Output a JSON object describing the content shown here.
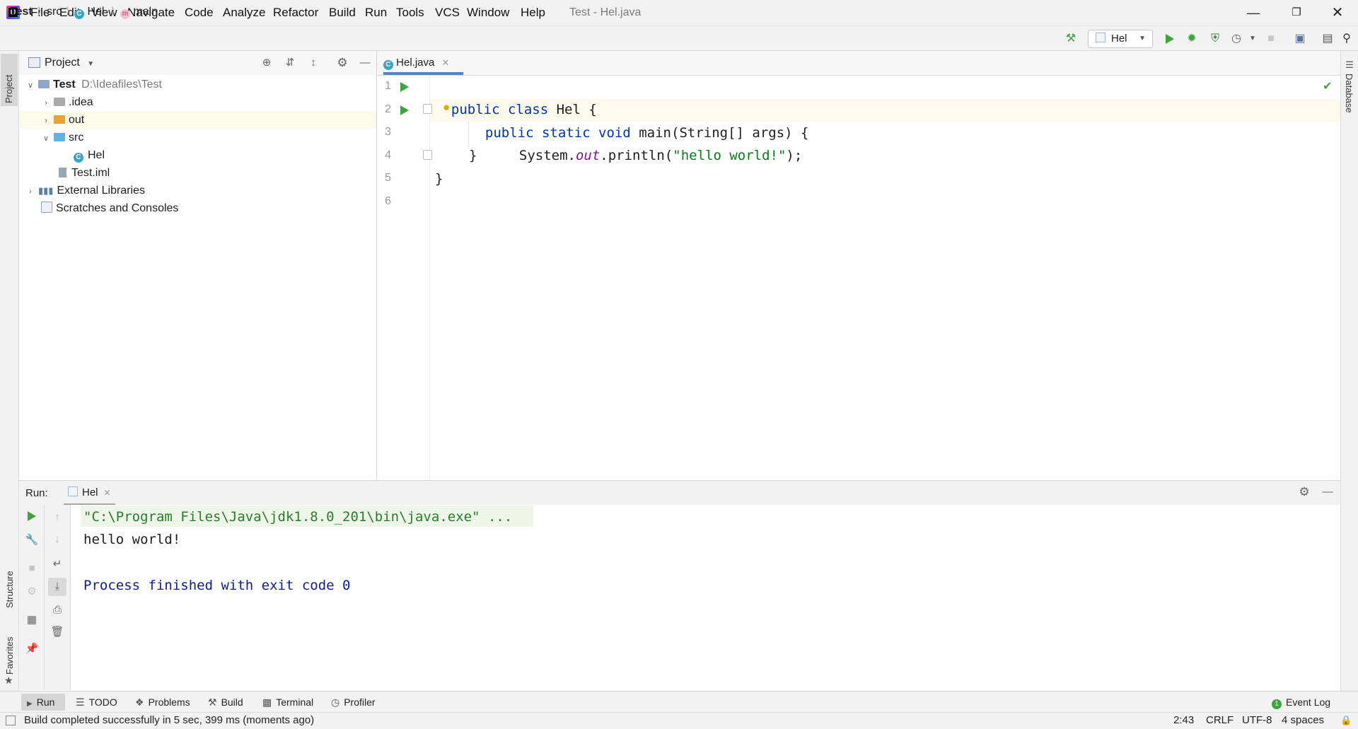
{
  "menu": [
    "File",
    "Edit",
    "View",
    "Navigate",
    "Code",
    "Analyze",
    "Refactor",
    "Build",
    "Run",
    "Tools",
    "VCS",
    "Window",
    "Help"
  ],
  "window_title": "Test - Hel.java",
  "breadcrumb": {
    "project": "Test",
    "folder": "src",
    "class": "Hel",
    "method": "main"
  },
  "run_config": "Hel",
  "project_panel": {
    "title": "Project",
    "tree": [
      {
        "label": "Test",
        "extra": "D:\\Ideafiles\\Test"
      },
      {
        "label": ".idea"
      },
      {
        "label": "out"
      },
      {
        "label": "src"
      },
      {
        "label": "Hel"
      },
      {
        "label": "Test.iml"
      },
      {
        "label": "External Libraries"
      },
      {
        "label": "Scratches and Consoles"
      }
    ]
  },
  "editor": {
    "tab": "Hel.java",
    "line_numbers": [
      "1",
      "2",
      "3",
      "4",
      "5",
      "6"
    ],
    "code": {
      "l1": {
        "kw": "public class",
        "rest": " Hel {"
      },
      "l2": {
        "kw": "public static void",
        "name": " main",
        "rest": "(String[] args) {"
      },
      "l3": {
        "pre": "System.",
        "field": "out",
        "mid": ".println(",
        "str": "\"hello world!\"",
        "post": ");"
      },
      "l4": "}",
      "l5": "}"
    }
  },
  "run_window": {
    "label": "Run:",
    "tab": "Hel",
    "console": [
      "\"C:\\Program Files\\Java\\jdk1.8.0_201\\bin\\java.exe\" ...",
      "hello world!",
      "Process finished with exit code 0"
    ]
  },
  "side_tabs": {
    "left_top": "Project",
    "left_structure": "Structure",
    "left_favorites": "Favorites",
    "right": "Database"
  },
  "tool_tabs": [
    "Run",
    "TODO",
    "Problems",
    "Build",
    "Terminal",
    "Profiler"
  ],
  "event_log": "Event Log",
  "status": {
    "message": "Build completed successfully in 5 sec, 399 ms (moments ago)",
    "position": "2:43",
    "line_ending": "CRLF",
    "encoding": "UTF-8",
    "indent": "4 spaces"
  },
  "colors": {
    "accent": "#4a88c7",
    "run_green": "#3fa33f",
    "keyword": "#0033b3",
    "string": "#067d17"
  }
}
